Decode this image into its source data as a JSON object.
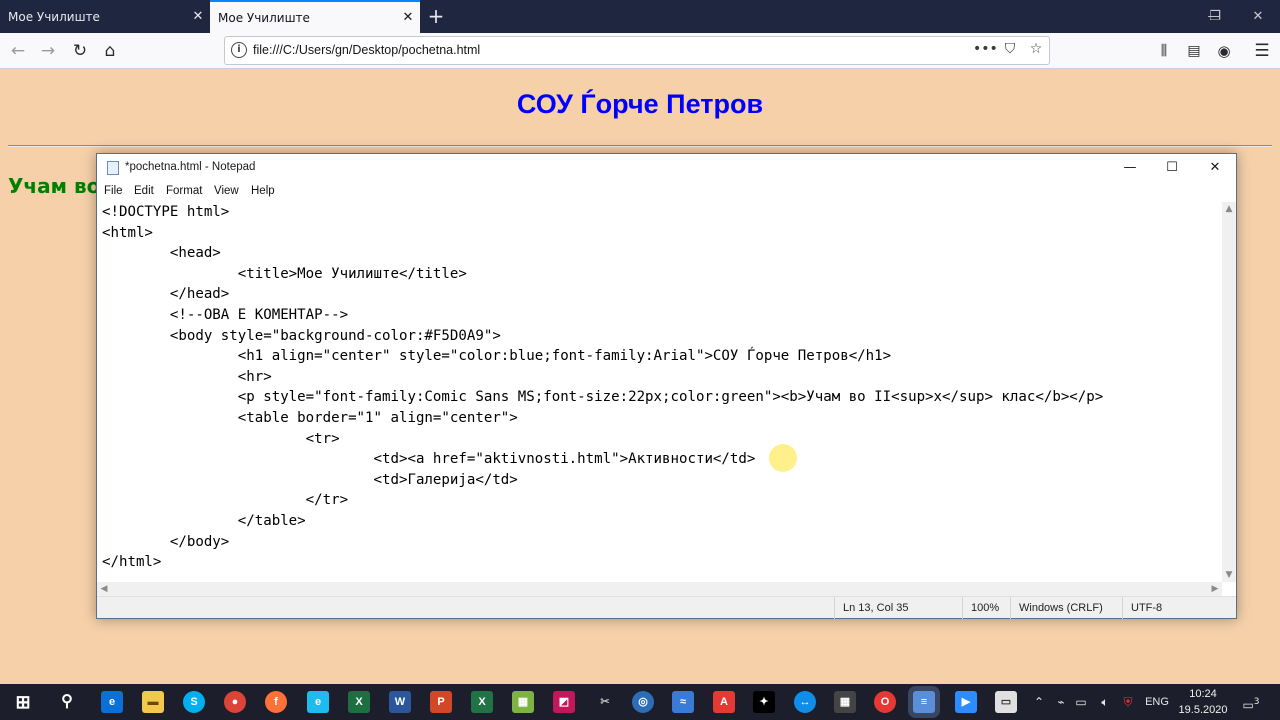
{
  "browser": {
    "tabs": [
      {
        "label": "Мое Училиште",
        "active": false
      },
      {
        "label": "Мое Училиште",
        "active": true
      }
    ],
    "new_tab_icon": "plus-icon",
    "window_controls": [
      "—",
      "❐",
      "✕"
    ],
    "url": "file:///C:/Users/gn/Desktop/pochetna.html",
    "toolbar_icons": [
      "back-icon",
      "forward-icon",
      "reload-icon",
      "home-icon",
      "page-actions-icon",
      "pocket-icon",
      "bookmark-star-icon",
      "library-icon",
      "sidebar-icon",
      "account-icon",
      "menu-icon"
    ]
  },
  "page": {
    "background": "#F5D0A9",
    "h1": "СОУ Ѓорче Петров",
    "h1_color": "#0000ff",
    "p_text": "Учам во",
    "p_color": "#008000"
  },
  "notepad": {
    "title": "*pochetna.html - Notepad",
    "menu": [
      "File",
      "Edit",
      "Format",
      "View",
      "Help"
    ],
    "code_lines": [
      "<!DOCTYPE html>",
      "<html>",
      "        <head>",
      "                <title>Мое Училиште</title>",
      "        </head>",
      "        <!--ОВА Е КОМЕНТАР-->",
      "        <body style=\"background-color:#F5D0A9\">",
      "                <h1 align=\"center\" style=\"color:blue;font-family:Arial\">СОУ Ѓорче Петров</h1>",
      "                <hr>",
      "                <p style=\"font-family:Comic Sans MS;font-size:22px;color:green\"><b>Учам во II<sup>x</sup> клас</b></p>",
      "                <table border=\"1\" align=\"center\">",
      "                        <tr>",
      "                                <td><a href=\"aktivnosti.html\">Активности</td>",
      "                                <td>Галерија</td>",
      "                        </tr>",
      "                </table>",
      "        </body>",
      "</html>"
    ],
    "status": {
      "position": "Ln 13, Col 35",
      "zoom": "100%",
      "line_endings": "Windows (CRLF)",
      "encoding": "UTF-8"
    }
  },
  "taskbar": {
    "icons": [
      "windows-start-icon",
      "search-icon",
      "edge-icon",
      "file-explorer-icon",
      "skype-icon",
      "chrome-icon",
      "firefox-icon",
      "ie-icon",
      "excel-icon",
      "word-icon",
      "powerpoint-icon",
      "excel-2-icon",
      "app-grid-icon",
      "paint-icon",
      "snipping-icon",
      "app-circle-icon",
      "network-icon",
      "pdf-icon",
      "app-black-icon",
      "teamviewer-icon",
      "calculator-icon",
      "opera-icon",
      "notepad-icon",
      "zoom-icon",
      "file-icon"
    ],
    "language": "ENG",
    "time": "10:24",
    "date": "19.5.2020",
    "notification_count": "3"
  }
}
